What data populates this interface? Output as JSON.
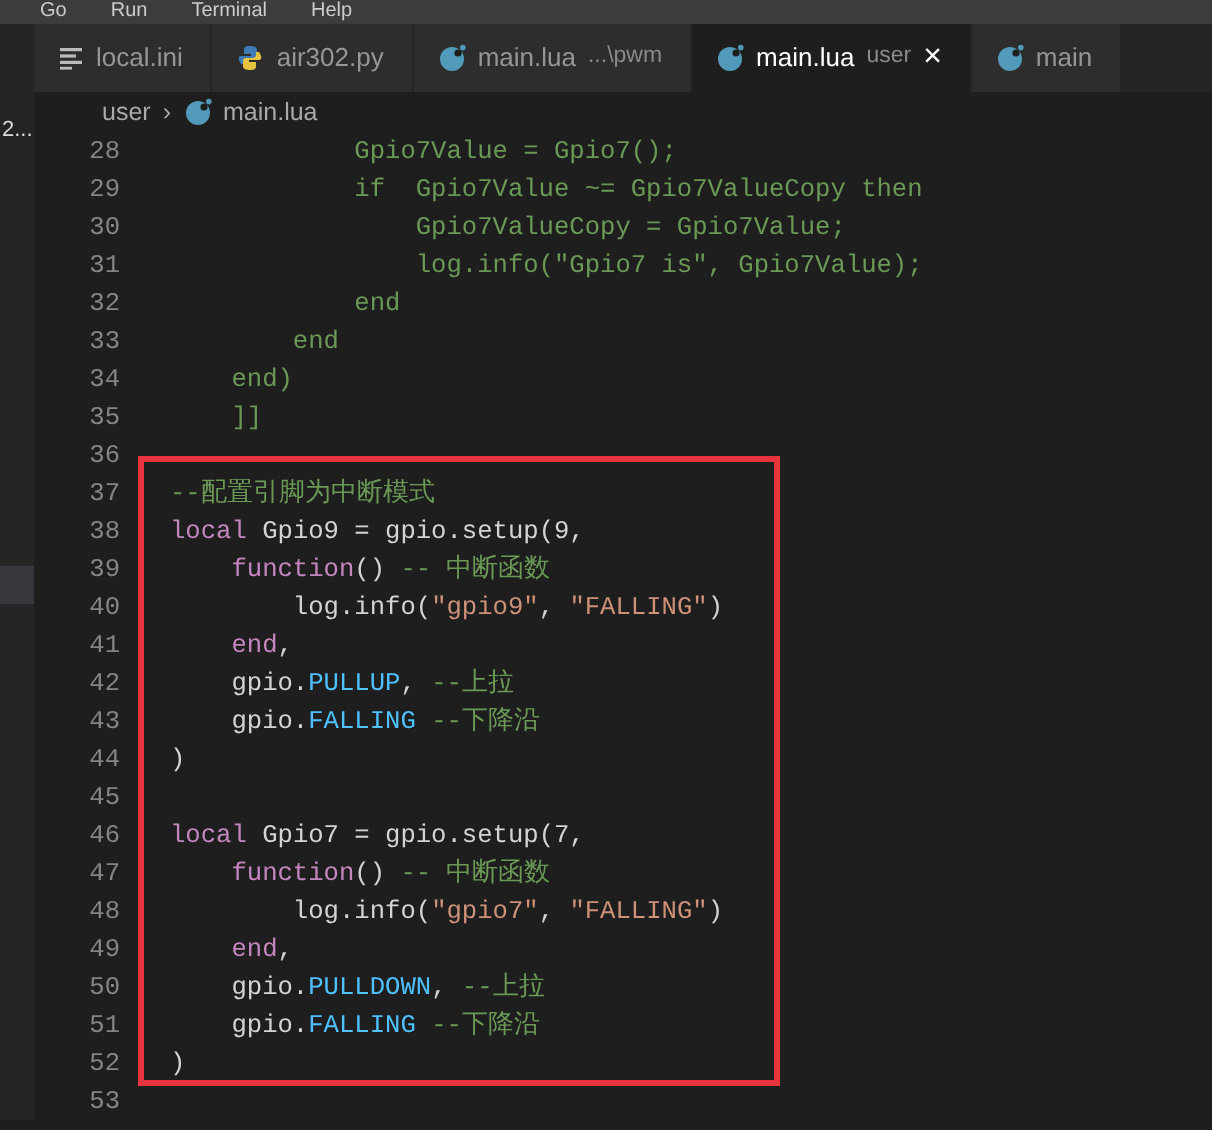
{
  "menu": [
    "Go",
    "Run",
    "Terminal",
    "Help"
  ],
  "tabs": [
    {
      "label": "local.ini",
      "kind": "text",
      "selected": false
    },
    {
      "label": "air302.py",
      "kind": "python",
      "selected": false
    },
    {
      "label": "main.lua",
      "description": "...\\pwm",
      "kind": "lua",
      "selected": false
    },
    {
      "label": "main.lua",
      "description": "user",
      "kind": "lua",
      "selected": true,
      "close": "×"
    },
    {
      "label": "main",
      "kind": "lua",
      "selected": false
    }
  ],
  "sidebar": {
    "label": "2..."
  },
  "breadcrumb": {
    "folder": "user",
    "separator": "›",
    "file": "main.lua"
  },
  "code": {
    "lines_before": [
      {
        "number": "28",
        "tokens": [
          {
            "kind": "comment",
            "text": "            Gpio7Value = Gpio7();"
          }
        ]
      },
      {
        "number": "29",
        "tokens": [
          {
            "kind": "comment",
            "text": "            if  Gpio7Value ~= Gpio7ValueCopy then"
          }
        ]
      },
      {
        "number": "30",
        "tokens": [
          {
            "kind": "comment",
            "text": "                Gpio7ValueCopy = Gpio7Value;"
          }
        ]
      },
      {
        "number": "31",
        "tokens": [
          {
            "kind": "comment",
            "text": "                log.info(\"Gpio7 is\", Gpio7Value);"
          }
        ]
      },
      {
        "number": "32",
        "tokens": [
          {
            "kind": "comment",
            "text": "            end"
          }
        ]
      },
      {
        "number": "33",
        "tokens": [
          {
            "kind": "comment",
            "text": "        end"
          }
        ]
      },
      {
        "number": "34",
        "tokens": [
          {
            "kind": "comment",
            "text": "    end)"
          }
        ]
      },
      {
        "number": "35",
        "tokens": [
          {
            "kind": "comment",
            "text": "    ]]"
          }
        ]
      },
      {
        "number": "36"
      }
    ],
    "highlight_box": [
      {
        "number": "37",
        "tokens": [
          {
            "kind": "comment",
            "text": "--配置引脚为中断模式"
          }
        ]
      },
      {
        "number": "38",
        "tokens": [
          {
            "kind": "keyword",
            "text": "local"
          },
          {
            "kind": "plain",
            "text": " Gpio9 = gpio.setup(9,"
          }
        ]
      },
      {
        "number": "39",
        "tokens": [
          {
            "kind": "keyword",
            "text": "    function"
          },
          {
            "kind": "plain",
            "text": "() "
          },
          {
            "kind": "comment",
            "text": "-- 中断函数"
          }
        ]
      },
      {
        "number": "40",
        "tokens": [
          {
            "kind": "plain",
            "text": "        log.info("
          },
          {
            "kind": "string",
            "text": "\"gpio9\""
          },
          {
            "kind": "plain",
            "text": ", "
          },
          {
            "kind": "string",
            "text": "\"FALLING\""
          },
          {
            "kind": "plain",
            "text": ")"
          }
        ]
      },
      {
        "number": "41",
        "tokens": [
          {
            "kind": "keyword",
            "text": "    end"
          },
          {
            "kind": "plain",
            "text": ","
          }
        ]
      },
      {
        "number": "42",
        "tokens": [
          {
            "kind": "plain",
            "text": "    gpio."
          },
          {
            "kind": "constant",
            "text": "PULLUP"
          },
          {
            "kind": "plain",
            "text": ", "
          },
          {
            "kind": "comment",
            "text": "--上拉"
          }
        ]
      },
      {
        "number": "43",
        "tokens": [
          {
            "kind": "plain",
            "text": "    gpio."
          },
          {
            "kind": "constant",
            "text": "FALLING"
          },
          {
            "kind": "comment",
            "text": " --下降沿"
          }
        ]
      },
      {
        "number": "44",
        "tokens": [
          {
            "kind": "plain",
            "text": ")"
          }
        ]
      },
      {
        "number": "45"
      },
      {
        "number": "46",
        "tokens": [
          {
            "kind": "keyword",
            "text": "local"
          },
          {
            "kind": "plain",
            "text": " Gpio7 = gpio.setup(7,"
          }
        ]
      },
      {
        "number": "47",
        "tokens": [
          {
            "kind": "keyword",
            "text": "    function"
          },
          {
            "kind": "plain",
            "text": "() "
          },
          {
            "kind": "comment",
            "text": "-- 中断函数"
          }
        ]
      },
      {
        "number": "48",
        "tokens": [
          {
            "kind": "plain",
            "text": "        log.info("
          },
          {
            "kind": "string",
            "text": "\"gpio7\""
          },
          {
            "kind": "plain",
            "text": ", "
          },
          {
            "kind": "string",
            "text": "\"FALLING\""
          },
          {
            "kind": "plain",
            "text": ")"
          }
        ]
      },
      {
        "number": "49",
        "tokens": [
          {
            "kind": "keyword",
            "text": "    end"
          },
          {
            "kind": "plain",
            "text": ","
          }
        ]
      },
      {
        "number": "50",
        "tokens": [
          {
            "kind": "plain",
            "text": "    gpio."
          },
          {
            "kind": "constant",
            "text": "PULLDOWN"
          },
          {
            "kind": "plain",
            "text": ", "
          },
          {
            "kind": "comment",
            "text": "--上拉"
          }
        ]
      },
      {
        "number": "51",
        "tokens": [
          {
            "kind": "plain",
            "text": "    gpio."
          },
          {
            "kind": "constant",
            "text": "FALLING"
          },
          {
            "kind": "comment",
            "text": " --下降沿"
          }
        ]
      },
      {
        "number": "52",
        "tokens": [
          {
            "kind": "plain",
            "text": ")"
          }
        ]
      }
    ],
    "lines_after": [
      {
        "number": "53"
      }
    ]
  }
}
